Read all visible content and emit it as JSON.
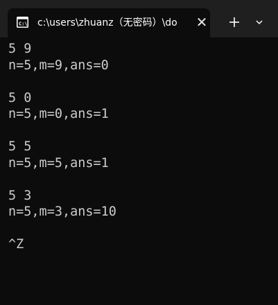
{
  "tab": {
    "title": "c:\\users\\zhuanz（无密码）\\do",
    "icon": "console-icon",
    "close_icon": "close-icon"
  },
  "toolbar": {
    "new_tab_icon": "plus-icon",
    "dropdown_icon": "chevron-down-icon"
  },
  "console": {
    "lines": [
      "5 9",
      "n=5,m=9,ans=0",
      "",
      "5 0",
      "n=5,m=0,ans=1",
      "",
      "5 5",
      "n=5,m=5,ans=1",
      "",
      "5 3",
      "n=5,m=3,ans=10",
      "",
      "^Z"
    ]
  },
  "colors": {
    "background": "#0c0c0c",
    "tabbar": "#1f1f1f",
    "text": "#cccccc"
  }
}
